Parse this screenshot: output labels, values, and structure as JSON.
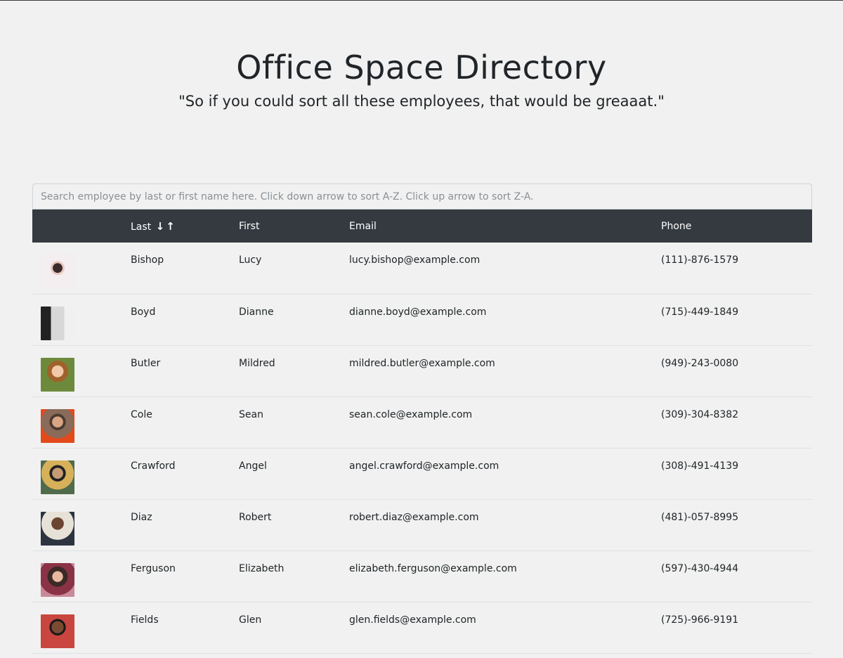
{
  "header": {
    "title": "Office Space Directory",
    "subtitle": "\"So if you could sort all these employees, that would be greaaat.\""
  },
  "search": {
    "placeholder": "Search employee by last or first name here. Click down arrow to sort A-Z. Click up arrow to sort Z-A.",
    "value": ""
  },
  "table": {
    "columns": {
      "image": "",
      "last": "Last",
      "sort_down": "↓",
      "sort_up": "↑",
      "first": "First",
      "email": "Email",
      "phone": "Phone"
    },
    "rows": [
      {
        "last": "Bishop",
        "first": "Lucy",
        "email": "lucy.bishop@example.com",
        "phone": "(111)-876-1579"
      },
      {
        "last": "Boyd",
        "first": "Dianne",
        "email": "dianne.boyd@example.com",
        "phone": "(715)-449-1849"
      },
      {
        "last": "Butler",
        "first": "Mildred",
        "email": "mildred.butler@example.com",
        "phone": "(949)-243-0080"
      },
      {
        "last": "Cole",
        "first": "Sean",
        "email": "sean.cole@example.com",
        "phone": "(309)-304-8382"
      },
      {
        "last": "Crawford",
        "first": "Angel",
        "email": "angel.crawford@example.com",
        "phone": "(308)-491-4139"
      },
      {
        "last": "Diaz",
        "first": "Robert",
        "email": "robert.diaz@example.com",
        "phone": "(481)-057-8995"
      },
      {
        "last": "Ferguson",
        "first": "Elizabeth",
        "email": "elizabeth.ferguson@example.com",
        "phone": "(597)-430-4944"
      },
      {
        "last": "Fields",
        "first": "Glen",
        "email": "glen.fields@example.com",
        "phone": "(725)-966-9191"
      }
    ]
  }
}
